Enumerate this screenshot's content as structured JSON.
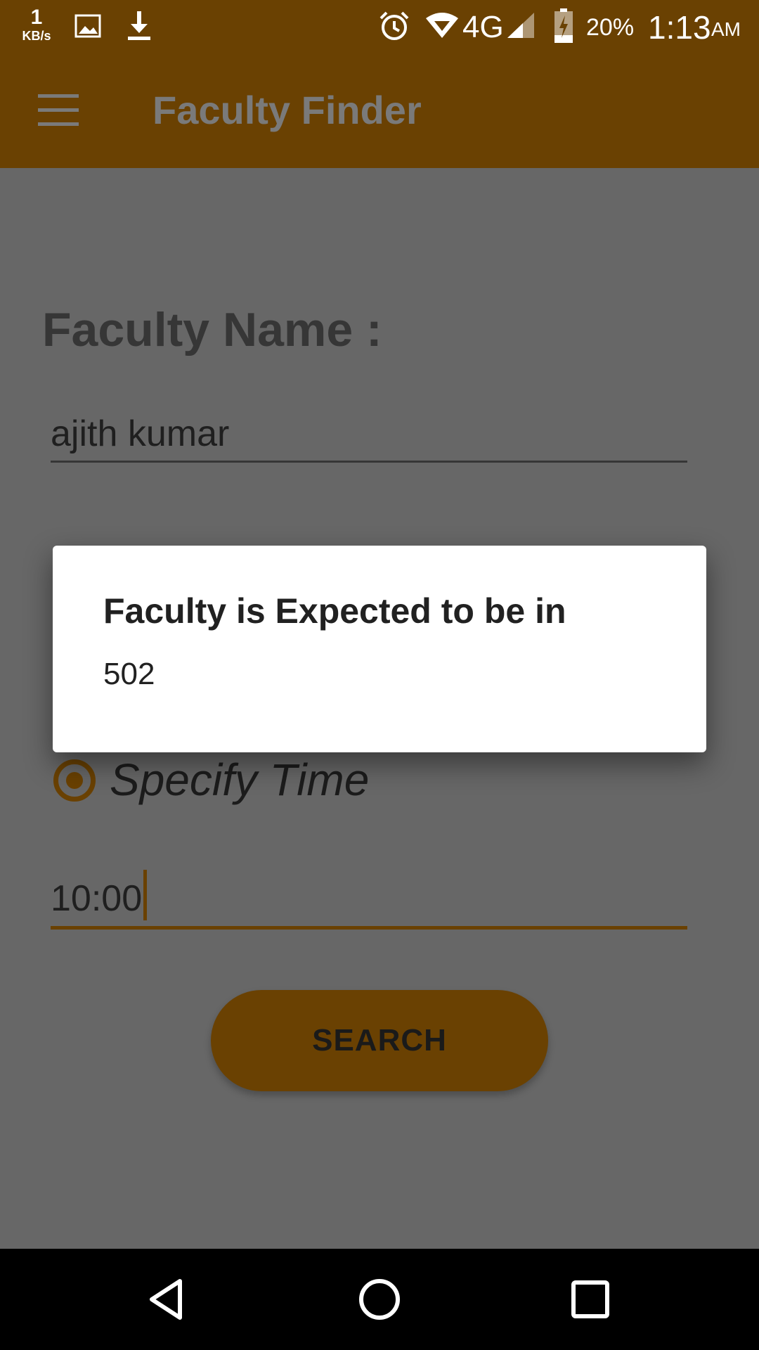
{
  "status_bar": {
    "net_speed_value": "1",
    "net_speed_unit": "KB/s",
    "network_type": "4G",
    "battery_percent": "20%",
    "time": "1:13",
    "ampm": "AM",
    "icons": [
      "image-notification-icon",
      "download-icon",
      "alarm-icon",
      "wifi-icon",
      "signal-icon",
      "battery-charging-icon"
    ]
  },
  "app_bar": {
    "title": "Faculty Finder",
    "menu_icon": "menu-icon"
  },
  "form": {
    "faculty_name_label": "Faculty Name :",
    "faculty_name_value": "ajith kumar",
    "time_option_label": "Specify Time",
    "time_value": "10:00",
    "search_button": "SEARCH"
  },
  "dialog": {
    "title": "Faculty is Expected to be in",
    "message": "502"
  },
  "nav_bar": {
    "icons": [
      "back-icon",
      "home-icon",
      "recents-icon"
    ]
  },
  "colors": {
    "primary": "#6a4102",
    "scrim_background": "#676767",
    "dialog_background": "#ffffff"
  }
}
